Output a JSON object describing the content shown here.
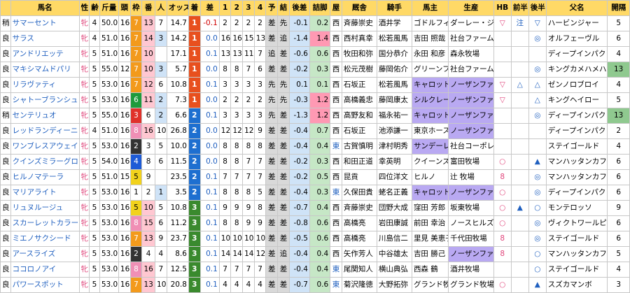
{
  "headers": [
    "",
    "馬名",
    "性",
    "齢",
    "斤量",
    "頭",
    "枠",
    "番",
    "人",
    "オッズ",
    "着",
    "差",
    "1",
    "2",
    "3",
    "4",
    "予",
    "結",
    "後差",
    "詰脚",
    "屋",
    "厩舎",
    "騎手",
    "馬主",
    "生産",
    "HB",
    "前半",
    "後半",
    "父名",
    "開隔"
  ],
  "rows": [
    {
      "baba": "稍",
      "name": "サマーセント",
      "sex": "牝",
      "age": "4",
      "kin": "50.0",
      "tou": "16",
      "waku": "7",
      "ban": "13",
      "nin": "7",
      "odds": "14.7",
      "chaku": "1",
      "sa": "-0.1",
      "p1": "2",
      "p2": "2",
      "p3": "2",
      "p4": "2",
      "yo": "差",
      "ketsu": "先",
      "atosa": "-0.1",
      "tsume": "0.2",
      "ya": "西",
      "kyusha": "斉藤崇史",
      "kishu": "酒井学",
      "banushi": "ゴドルフィン",
      "seisan": "ダーレー・ジ",
      "hb": "▽",
      "zen": "注",
      "kou": "▽",
      "chichi": "ハービンジャー",
      "kankaku": "5",
      "rank": "1"
    },
    {
      "baba": "良",
      "name": "サラス",
      "sex": "牝",
      "age": "4",
      "kin": "51.0",
      "tou": "16",
      "waku": "7",
      "ban": "14",
      "nin": "3",
      "odds": "14.2",
      "chaku": "1",
      "sa": "0.0",
      "p1": "16",
      "p2": "16",
      "p3": "15",
      "p4": "13",
      "yo": "差",
      "ketsu": "追",
      "atosa": "-1.4",
      "tsume": "1.4",
      "ya": "西",
      "kyusha": "西村真幸",
      "kishu": "松若風馬",
      "banushi": "吉田 照哉",
      "seisan": "社台ファーム",
      "hb": "",
      "zen": "",
      "kou": "◎",
      "chichi": "オルフェーヴル",
      "kankaku": "6",
      "rank": "1"
    },
    {
      "baba": "良",
      "name": "アンドリエッテ",
      "sex": "牝",
      "age": "5",
      "kin": "51.0",
      "tou": "16",
      "waku": "7",
      "ban": "10",
      "nin": "",
      "odds": "17.1",
      "chaku": "1",
      "sa": "0.1",
      "p1": "13",
      "p2": "13",
      "p3": "11",
      "p4": "7",
      "yo": "追",
      "ketsu": "差",
      "atosa": "-0.6",
      "tsume": "0.6",
      "ya": "西",
      "kyusha": "牧田和弥",
      "kishu": "国分恭介",
      "banushi": "永田 和彦",
      "seisan": "森永牧場",
      "hb": "",
      "zen": "",
      "kou": "",
      "chichi": "ディープインパクト",
      "kankaku": "4",
      "rank": "1"
    },
    {
      "baba": "良",
      "name": "マキシマムドパリ",
      "sex": "牝",
      "age": "5",
      "kin": "55.0",
      "tou": "12",
      "waku": "7",
      "ban": "10",
      "nin": "3",
      "odds": "5.7",
      "chaku": "1",
      "sa": "0.0",
      "p1": "8",
      "p2": "8",
      "p3": "7",
      "p4": "6",
      "yo": "差",
      "ketsu": "差",
      "atosa": "-0.2",
      "tsume": "0.3",
      "ya": "西",
      "kyusha": "松元茂樹",
      "kishu": "藤岡佑介",
      "banushi": "グリーンファ",
      "seisan": "社台ファーム",
      "hb": "",
      "zen": "",
      "kou": "◎",
      "chichi": "キングカメハメハ",
      "kankaku": "13",
      "rank": "1"
    },
    {
      "baba": "良",
      "name": "リラヴァティ",
      "sex": "牝",
      "age": "5",
      "kin": "53.0",
      "tou": "16",
      "waku": "7",
      "ban": "12",
      "nin": "6",
      "odds": "10.8",
      "chaku": "1",
      "sa": "0.1",
      "p1": "3",
      "p2": "3",
      "p3": "3",
      "p4": "3",
      "yo": "先",
      "ketsu": "先",
      "atosa": "0.1",
      "tsume": "0.1",
      "ya": "西",
      "kyusha": "石坂正",
      "kishu": "松若風馬",
      "banushi": "キャロットフ",
      "seisan": "ノーザンファ",
      "hb": "▽",
      "zen": "△",
      "kou": "△",
      "chichi": "ゼンノロブロイ",
      "kankaku": "4",
      "rank": "1"
    },
    {
      "baba": "良",
      "name": "シャトーブランシュ",
      "sex": "牝",
      "age": "5",
      "kin": "53.0",
      "tou": "16",
      "waku": "6",
      "ban": "11",
      "nin": "2",
      "odds": "7.3",
      "chaku": "1",
      "sa": "0.0",
      "p1": "2",
      "p2": "2",
      "p3": "2",
      "p4": "2",
      "yo": "先",
      "ketsu": "先",
      "atosa": "-0.3",
      "tsume": "1.2",
      "ya": "西",
      "kyusha": "高橋義忠",
      "kishu": "藤岡康太",
      "banushi": "シルクレーシ",
      "seisan": "ノーザンファ",
      "hb": "▽",
      "zen": "",
      "kou": "△",
      "chichi": "キングヘイロー",
      "kankaku": "5",
      "rank": "1"
    },
    {
      "baba": "稍",
      "name": "センテリュオ",
      "sex": "牝",
      "age": "5",
      "kin": "55.0",
      "tou": "16",
      "waku": "3",
      "ban": "6",
      "nin": "2",
      "odds": "6.6",
      "chaku": "2",
      "sa": "0.1",
      "p1": "3",
      "p2": "3",
      "p3": "3",
      "p4": "3",
      "yo": "先",
      "ketsu": "差",
      "atosa": "-1.3",
      "tsume": "1.2",
      "ya": "西",
      "kyusha": "高野友和",
      "kishu": "福永祐一",
      "banushi": "キャロットフ",
      "seisan": "ノーザンファ",
      "hb": "",
      "zen": "",
      "kou": "◎",
      "chichi": "ディープインパクト",
      "kankaku": "13",
      "rank": "2"
    },
    {
      "baba": "良",
      "name": "レッドランディーニ",
      "sex": "牝",
      "age": "4",
      "kin": "51.0",
      "tou": "16",
      "waku": "8",
      "ban": "16",
      "nin": "10",
      "odds": "26.8",
      "chaku": "2",
      "sa": "0.0",
      "p1": "12",
      "p2": "12",
      "p3": "12",
      "p4": "9",
      "yo": "差",
      "ketsu": "差",
      "atosa": "-0.4",
      "tsume": "0.7",
      "ya": "西",
      "kyusha": "石坂正",
      "kishu": "池添謙一",
      "banushi": "東京ホースレ",
      "seisan": "ノーザンファ",
      "hb": "",
      "zen": "",
      "kou": "",
      "chichi": "ディープインパクト",
      "kankaku": "2",
      "rank": "2"
    },
    {
      "baba": "良",
      "name": "ワンブレスアウェイ",
      "sex": "牝",
      "age": "5",
      "kin": "53.0",
      "tou": "16",
      "waku": "2",
      "ban": "3",
      "nin": "5",
      "odds": "10.0",
      "chaku": "2",
      "sa": "0.0",
      "p1": "8",
      "p2": "8",
      "p3": "8",
      "p4": "8",
      "yo": "差",
      "ketsu": "差",
      "atosa": "-0.4",
      "tsume": "0.4",
      "ya": "東",
      "kyusha": "古賀慎明",
      "kishu": "津村明秀",
      "banushi": "サンデーレー",
      "seisan": "社台コーポレ",
      "hb": "",
      "zen": "",
      "kou": "",
      "chichi": "ステイゴールド",
      "kankaku": "4",
      "rank": "2"
    },
    {
      "baba": "良",
      "name": "クインズミラーグロ",
      "sex": "牝",
      "age": "5",
      "kin": "54.0",
      "tou": "16",
      "waku": "4",
      "ban": "8",
      "nin": "6",
      "odds": "11.5",
      "chaku": "2",
      "sa": "0.0",
      "p1": "8",
      "p2": "8",
      "p3": "7",
      "p4": "7",
      "yo": "差",
      "ketsu": "差",
      "atosa": "-0.2",
      "tsume": "0.3",
      "ya": "西",
      "kyusha": "和田正道",
      "kishu": "幸英明",
      "banushi": "クイーンズ・",
      "seisan": "富田牧場",
      "hb": "○",
      "zen": "",
      "kou": "▲",
      "chichi": "マンハッタンカフェ",
      "kankaku": "6",
      "rank": "2"
    },
    {
      "baba": "良",
      "name": "ヒルノマテーラ",
      "sex": "牝",
      "age": "5",
      "kin": "51.0",
      "tou": "15",
      "waku": "5",
      "ban": "9",
      "nin": "",
      "odds": "23.5",
      "chaku": "2",
      "sa": "0.1",
      "p1": "7",
      "p2": "7",
      "p3": "7",
      "p4": "7",
      "yo": "差",
      "ketsu": "差",
      "atosa": "-0.2",
      "tsume": "0.5",
      "ya": "西",
      "kyusha": "昆貢",
      "kishu": "四位洋文",
      "banushi": "ヒルノ",
      "seisan": "辻 牧場",
      "hb": "8",
      "zen": "",
      "kou": "◎",
      "chichi": "マンハッタンカフェ",
      "kankaku": "6",
      "rank": "2"
    },
    {
      "baba": "良",
      "name": "マリアライト",
      "sex": "牝",
      "age": "5",
      "kin": "53.0",
      "tou": "16",
      "waku": "1",
      "ban": "2",
      "nin": "1",
      "odds": "3.5",
      "chaku": "2",
      "sa": "0.1",
      "p1": "8",
      "p2": "8",
      "p3": "8",
      "p4": "5",
      "yo": "差",
      "ketsu": "差",
      "atosa": "-0.4",
      "tsume": "0.3",
      "ya": "東",
      "kyusha": "久保田貴",
      "kishu": "蛯名正義",
      "banushi": "キャロットフ",
      "seisan": "ノーザンファ",
      "hb": "○",
      "zen": "",
      "kou": "◎",
      "chichi": "ディープインパクト",
      "kankaku": "6",
      "rank": "2"
    },
    {
      "baba": "良",
      "name": "リュヌルージュ",
      "sex": "牝",
      "age": "5",
      "kin": "53.0",
      "tou": "16",
      "waku": "5",
      "ban": "10",
      "nin": "5",
      "odds": "10.8",
      "chaku": "3",
      "sa": "0.1",
      "p1": "9",
      "p2": "9",
      "p3": "9",
      "p4": "8",
      "yo": "差",
      "ketsu": "差",
      "atosa": "-0.7",
      "tsume": "0.4",
      "ya": "西",
      "kyusha": "斉藤崇史",
      "kishu": "団野大成",
      "banushi": "窪田 芳郎",
      "seisan": "坂東牧場",
      "hb": "○",
      "zen": "▲",
      "kou": "○",
      "chichi": "モンテロッソ",
      "kankaku": "9",
      "rank": "3"
    },
    {
      "baba": "良",
      "name": "スカーレットカラー",
      "sex": "牝",
      "age": "5",
      "kin": "53.0",
      "tou": "16",
      "waku": "8",
      "ban": "15",
      "nin": "6",
      "odds": "11.2",
      "chaku": "3",
      "sa": "0.1",
      "p1": "8",
      "p2": "8",
      "p3": "9",
      "p4": "9",
      "yo": "差",
      "ketsu": "差",
      "atosa": "-0.8",
      "tsume": "0.6",
      "ya": "西",
      "kyusha": "高橋亮",
      "kishu": "岩田康誠",
      "banushi": "前田 幸治",
      "seisan": "ノースヒルズ",
      "hb": "○",
      "zen": "",
      "kou": "◎",
      "chichi": "ヴィクトワールピサ",
      "kankaku": "6",
      "rank": "3"
    },
    {
      "baba": "良",
      "name": "ミエノサクシード",
      "sex": "牝",
      "age": "5",
      "kin": "53.0",
      "tou": "16",
      "waku": "7",
      "ban": "13",
      "nin": "9",
      "odds": "23.7",
      "chaku": "3",
      "sa": "0.1",
      "p1": "10",
      "p2": "10",
      "p3": "10",
      "p4": "10",
      "yo": "差",
      "ketsu": "差",
      "atosa": "-0.5",
      "tsume": "0.6",
      "ya": "西",
      "kyusha": "高橋亮",
      "kishu": "川島信二",
      "banushi": "里見 美恵子",
      "seisan": "千代田牧場",
      "hb": "8",
      "zen": "",
      "kou": "◎",
      "chichi": "ステイゴールド",
      "kankaku": "6",
      "rank": "3"
    },
    {
      "baba": "良",
      "name": "アースライズ",
      "sex": "牝",
      "age": "5",
      "kin": "53.0",
      "tou": "16",
      "waku": "2",
      "ban": "4",
      "nin": "4",
      "odds": "8.6",
      "chaku": "3",
      "sa": "0.1",
      "p1": "14",
      "p2": "14",
      "p3": "14",
      "p4": "12",
      "yo": "差",
      "ketsu": "追",
      "atosa": "-0.4",
      "tsume": "0.4",
      "ya": "西",
      "kyusha": "矢作芳人",
      "kishu": "中谷雄太",
      "banushi": "吉田 勝己",
      "seisan": "ノーザンファ",
      "hb": "8",
      "zen": "",
      "kou": "○",
      "chichi": "マンハッタンカフェ",
      "kankaku": "5",
      "rank": "3"
    },
    {
      "baba": "良",
      "name": "ココロノアイ",
      "sex": "牝",
      "age": "5",
      "kin": "53.0",
      "tou": "16",
      "waku": "8",
      "ban": "16",
      "nin": "7",
      "odds": "12.5",
      "chaku": "3",
      "sa": "0.1",
      "p1": "7",
      "p2": "7",
      "p3": "7",
      "p4": "7",
      "yo": "差",
      "ketsu": "差",
      "atosa": "-0.4",
      "tsume": "0.4",
      "ya": "東",
      "kyusha": "尾関知人",
      "kishu": "横山典弘",
      "banushi": "西森 鶴",
      "seisan": "酒井牧場",
      "hb": "",
      "zen": "",
      "kou": "○",
      "chichi": "ステイゴールド",
      "kankaku": "4",
      "rank": "3"
    },
    {
      "baba": "良",
      "name": "パワースポット",
      "sex": "牝",
      "age": "5",
      "kin": "53.0",
      "tou": "16",
      "waku": "7",
      "ban": "13",
      "nin": "10",
      "odds": "20.8",
      "chaku": "3",
      "sa": "0.1",
      "p1": "4",
      "p2": "4",
      "p3": "4",
      "p4": "4",
      "yo": "差",
      "ketsu": "差",
      "atosa": "-0.7",
      "tsume": "0.6",
      "ya": "東",
      "kyusha": "菊沢隆徳",
      "kishu": "大野拓弥",
      "banushi": "グランド牧場",
      "seisan": "グランド牧場",
      "hb": "○",
      "zen": "",
      "kou": "▲",
      "chichi": "スズカマンボ",
      "kankaku": "3",
      "rank": "3"
    }
  ]
}
